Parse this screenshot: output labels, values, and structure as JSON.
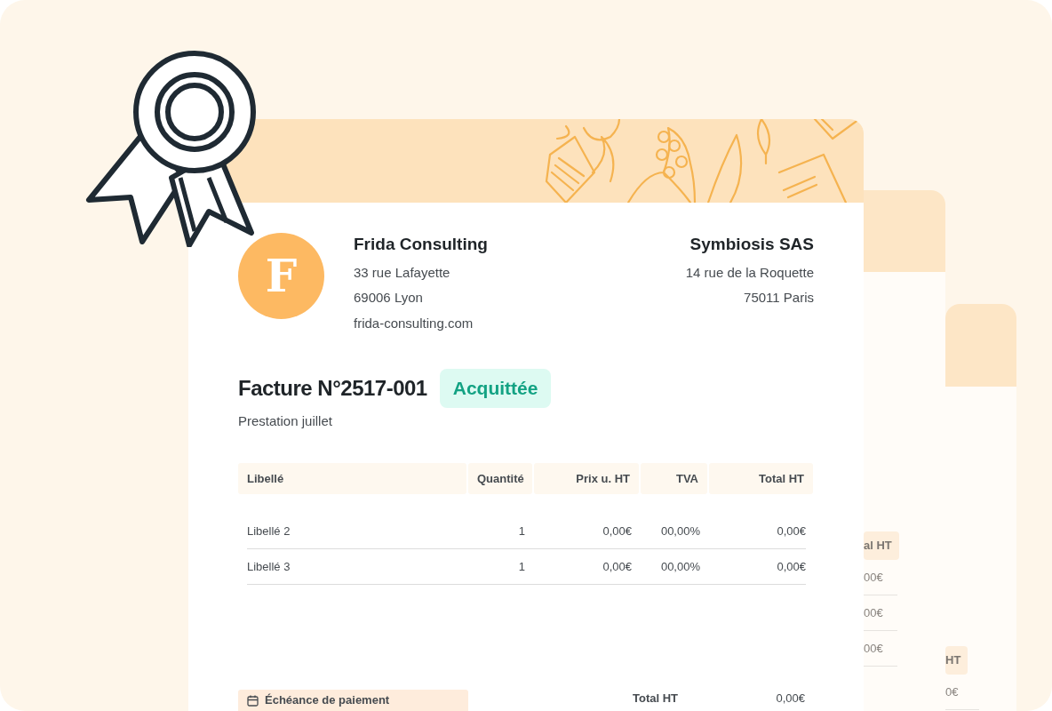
{
  "sender": {
    "initial": "F",
    "name": "Frida Consulting",
    "lines": [
      "33 rue Lafayette",
      "69006 Lyon",
      "frida-consulting.com"
    ]
  },
  "client": {
    "name": "Symbiosis SAS",
    "lines": [
      "14 rue de la Roquette",
      "75011 Paris"
    ]
  },
  "invoice": {
    "title": "Facture N°2517-001",
    "status": "Acquittée",
    "subtitle": "Prestation juillet"
  },
  "table": {
    "columns": [
      "Libellé",
      "Quantité",
      "Prix u. HT",
      "TVA",
      "Total HT"
    ],
    "rows": [
      [
        "Libellé 2",
        "1",
        "0,00€",
        "00,00%",
        "0,00€"
      ],
      [
        "Libellé 3",
        "1",
        "0,00€",
        "00,00%",
        "0,00€"
      ]
    ]
  },
  "due": {
    "label": "Échéance de paiement"
  },
  "totals": [
    {
      "label": "Total HT",
      "value": "0,00€"
    }
  ],
  "back_sheets": [
    {
      "header": "al HT",
      "cells": [
        "00€",
        "00€",
        "00€"
      ]
    },
    {
      "header": "HT",
      "cells": [
        "0€"
      ]
    }
  ]
}
